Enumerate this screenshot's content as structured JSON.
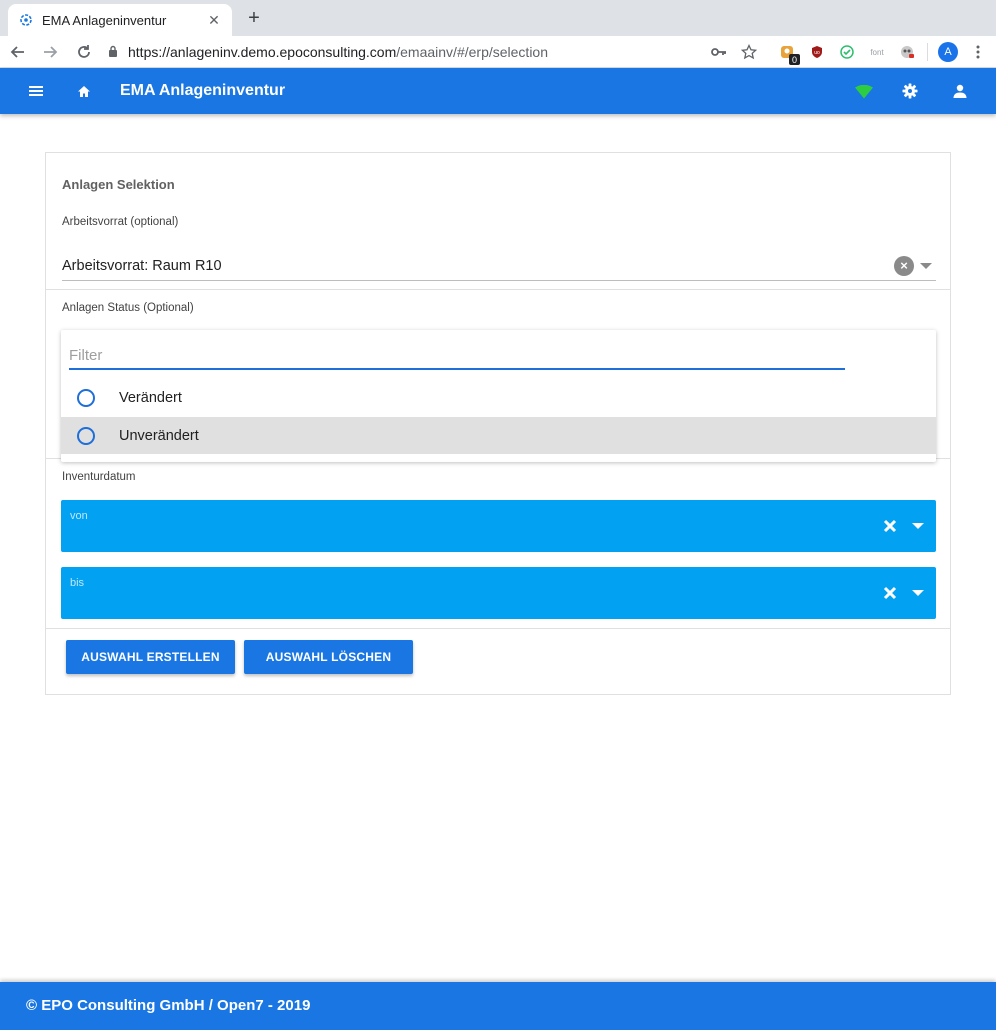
{
  "browser": {
    "tab_title": "EMA Anlageninventur",
    "new_tab_symbol": "+",
    "url_host": "https://anlageninv.demo.epoconsulting.com",
    "url_path": "/emaainv/#/erp/selection",
    "avatar_letter": "A",
    "extension_badge": "0",
    "font_extension_label": "font"
  },
  "appbar": {
    "title": "EMA Anlageninventur"
  },
  "selection": {
    "section_title": "Anlagen Selektion",
    "arbeitsvorrat": {
      "label": "Arbeitsvorrat (optional)",
      "value": "Arbeitsvorrat: Raum R10"
    },
    "status": {
      "label": "Anlagen Status (Optional)",
      "filter_placeholder": "Filter",
      "options": [
        "Verändert",
        "Unverändert"
      ]
    },
    "inventurdatum": {
      "label": "Inventurdatum",
      "from_label": "von",
      "to_label": "bis"
    },
    "buttons": {
      "create": "AUSWAHL ERSTELLEN",
      "clear": "AUSWAHL LÖSCHEN"
    }
  },
  "footer": {
    "text": "© EPO Consulting GmbH / Open7 - 2019"
  },
  "colors": {
    "primary": "#1976e3",
    "date_field": "#03a1f1",
    "radio": "#1e6fd9",
    "wifi_status": "#2ecc40"
  }
}
